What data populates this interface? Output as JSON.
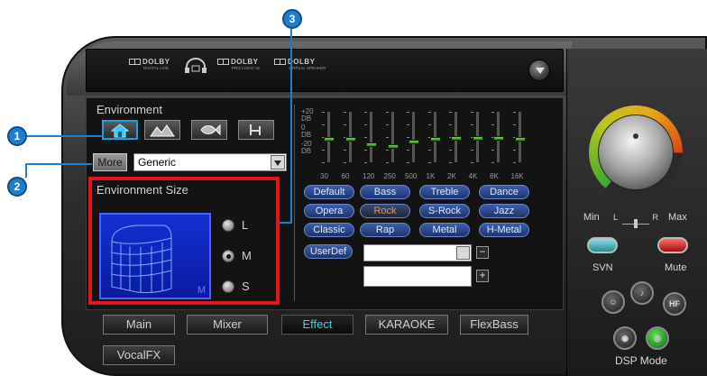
{
  "header": {
    "logos": [
      {
        "name": "DOLBY",
        "sub": "DIGITAL LIVE"
      },
      {
        "name": "DOLBY",
        "sub": "PRO LOGIC IIx"
      },
      {
        "name": "DOLBY",
        "sub": "VIRTUAL SPEAKER"
      }
    ]
  },
  "environment": {
    "title": "Environment",
    "more_label": "More",
    "selected": "Generic",
    "icons": [
      "house-icon",
      "mountains-icon",
      "fish-icon",
      "chair-icon"
    ]
  },
  "env_size": {
    "title": "Environment Size",
    "options": [
      "L",
      "M",
      "S"
    ],
    "selected": "M",
    "preview_tag": "M"
  },
  "eq": {
    "db_labels": [
      "+20",
      "DB",
      "0",
      "DB",
      "-20",
      "DB"
    ],
    "bands": [
      "30",
      "60",
      "120",
      "250",
      "500",
      "1K",
      "2K",
      "4K",
      "8K",
      "16K"
    ],
    "levels_db": [
      0,
      0,
      -4,
      -6,
      -2,
      0,
      1,
      1,
      1,
      0
    ],
    "presets": [
      [
        "Default",
        "Bass",
        "Treble",
        "Dance"
      ],
      [
        "Opera",
        "Rock",
        "S-Rock",
        "Jazz"
      ],
      [
        "Classic",
        "Rap",
        "Metal",
        "H-Metal"
      ]
    ],
    "selected_preset": "Rock",
    "userdef_label": "UserDef",
    "minus": "−",
    "plus": "+"
  },
  "tabs": [
    "Main",
    "Mixer",
    "Effect",
    "KARAOKE",
    "FlexBass",
    "VocalFX"
  ],
  "selected_tab": "Effect",
  "right": {
    "min_label": "Min",
    "max_label": "Max",
    "balance_l": "L",
    "balance_r": "R",
    "svn_label": "SVN",
    "mute_label": "Mute",
    "hf_label": "HF",
    "dsp_mode_label": "DSP Mode"
  },
  "callouts": [
    "1",
    "2",
    "3"
  ],
  "colors": {
    "accent_blue": "#1d7fcc",
    "highlight_red": "#e3141a",
    "tab_active": "#38d6e6",
    "rock_orange": "#ff8a3a"
  }
}
